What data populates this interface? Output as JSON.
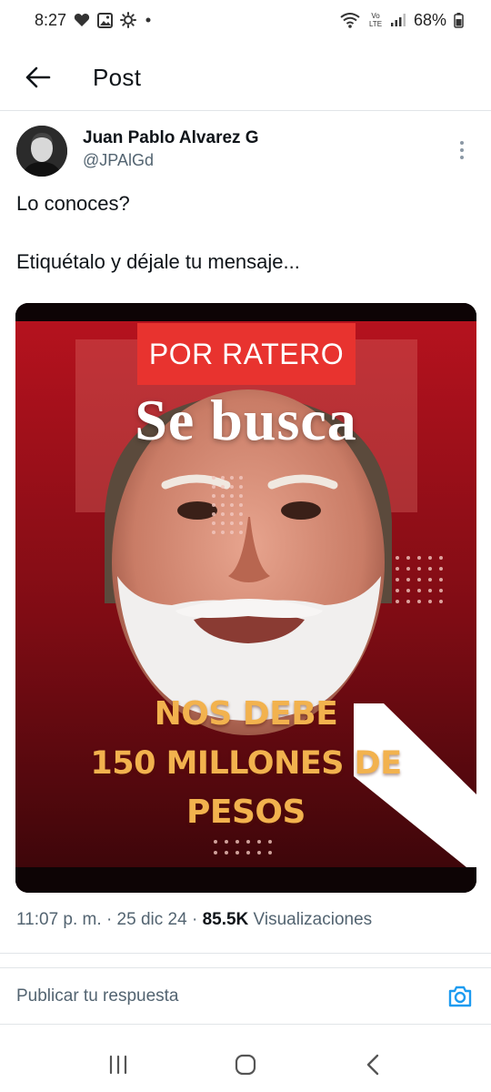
{
  "status_bar": {
    "time": "8:27",
    "battery": "68%",
    "icons_left": [
      "heart-icon",
      "image-icon",
      "settings-icon",
      "dot-icon"
    ],
    "icons_right": [
      "wifi-icon",
      "volte-icon",
      "signal-icon",
      "battery-icon"
    ],
    "volte_label": "Vo LTE"
  },
  "header": {
    "title": "Post"
  },
  "post": {
    "author_name": "Juan Pablo Alvarez G",
    "author_handle": "@JPAlGd",
    "text_line1": "Lo conoces?",
    "text_line2": "Etiquétalo y déjale tu mensaje...",
    "image": {
      "tag": "POR RATERO",
      "headline": "Se busca",
      "debt_line1": "NOS DEBE",
      "debt_line2": "150 MILLONES DE",
      "debt_line3": "PESOS"
    },
    "time": "11:07 p. m.",
    "date": "25 dic 24",
    "views_count": "85.5K",
    "views_label": "Visualizaciones"
  },
  "reply": {
    "placeholder": "Publicar tu respuesta"
  },
  "colors": {
    "accent": "#1d9bf0",
    "text_primary": "#0f1419",
    "text_secondary": "#536471",
    "poster_red": "#e8332f",
    "poster_gold": "#f2b24e"
  }
}
